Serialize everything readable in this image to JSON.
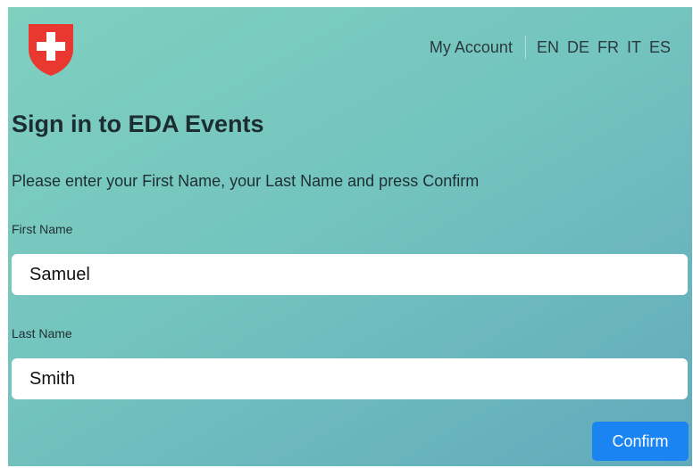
{
  "header": {
    "logo_icon": "swiss-cross-shield-icon",
    "my_account_label": "My Account",
    "languages": [
      "EN",
      "DE",
      "FR",
      "IT",
      "ES"
    ]
  },
  "main": {
    "title": "Sign in to EDA Events",
    "instructions": "Please enter your First Name, your Last Name and press Confirm",
    "first_name": {
      "label": "First Name",
      "value": "Samuel"
    },
    "last_name": {
      "label": "Last Name",
      "value": "Smith"
    },
    "confirm_label": "Confirm"
  },
  "colors": {
    "accent": "#1a84f3",
    "brand_red": "#e8382f",
    "background_start": "#7fd0bf",
    "background_end": "#62aabc"
  }
}
